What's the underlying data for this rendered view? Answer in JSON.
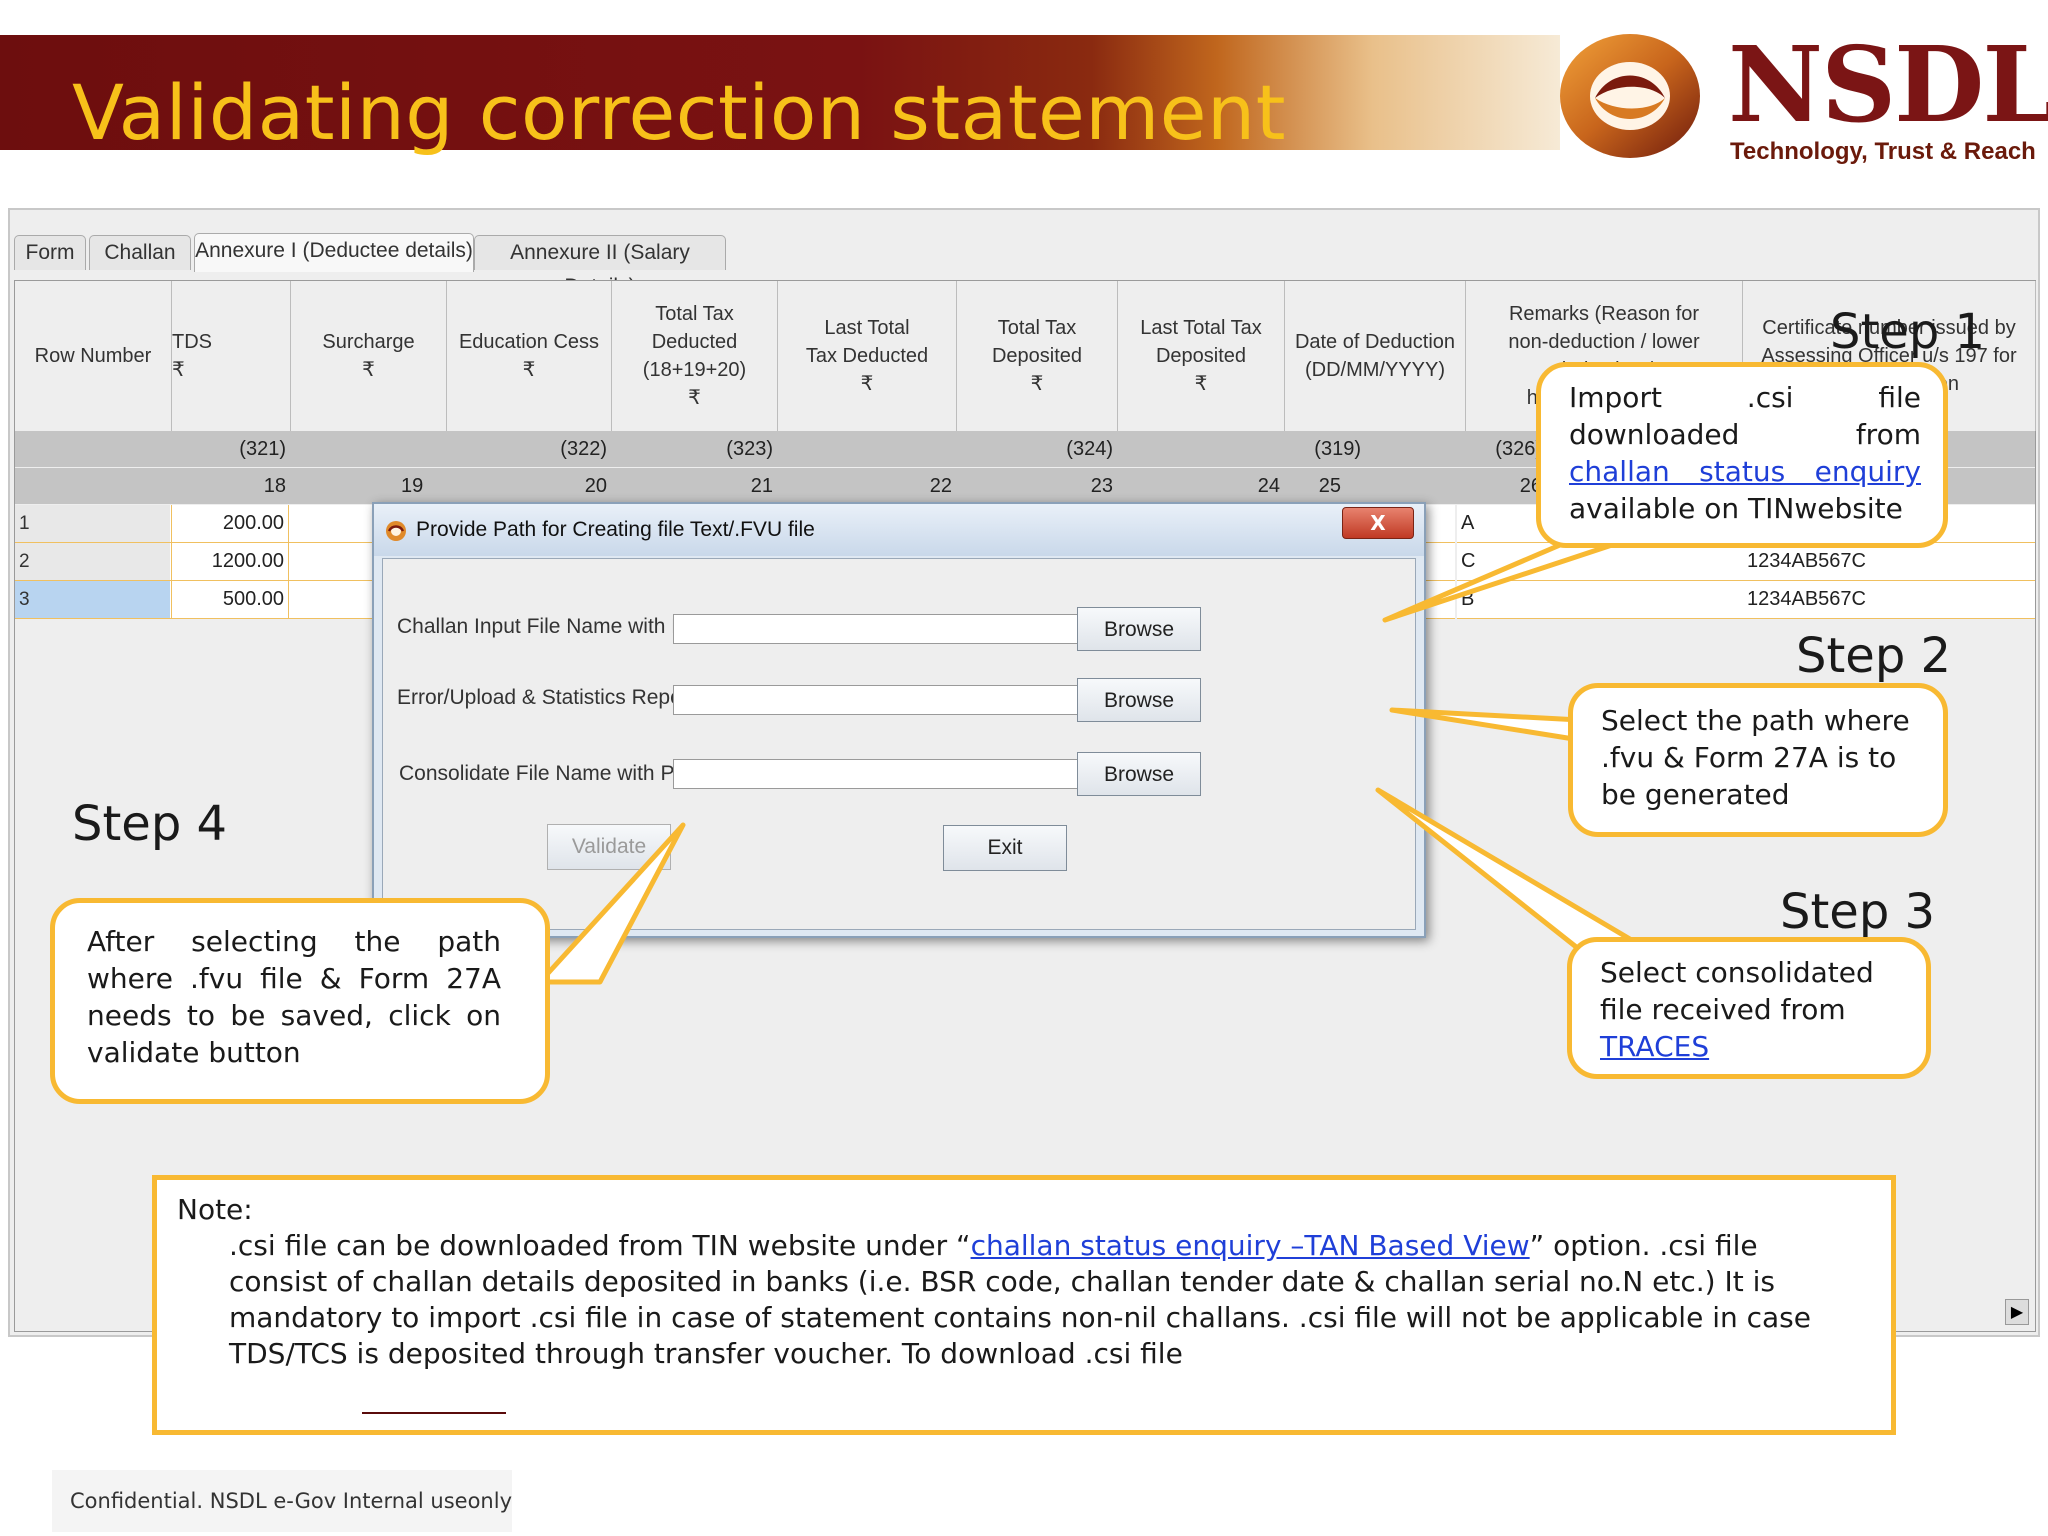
{
  "slide": {
    "title": "Validating correction statement",
    "logo_text": "NSDL",
    "logo_tagline": "Technology, Trust & Reach",
    "footer": "Confidential. NSDL e-Gov Internal useonly",
    "accent_color": "#f8b932",
    "banner_color": "#6d0e0e"
  },
  "app": {
    "tabs": [
      "Form",
      "Challan",
      "Annexure I (Deductee details)",
      "Annexure II (Salary Details)"
    ],
    "active_tab": "Annexure I (Deductee details)",
    "columns": [
      "Row Number",
      "TDS\n₹",
      "Surcharge\n₹",
      "Education Cess\n₹",
      "Total Tax Deducted\n(18+19+20)\n₹",
      "Last Total\nTax Deducted\n₹",
      "Total Tax\nDeposited\n₹",
      "Last Total Tax\nDeposited\n₹",
      "Date of Deduction\n(DD/MM/YYYY)",
      "Remarks (Reason for\nnon-deduction / lower deduction /\nhigher deduction)",
      "Certificate number issued by\nAssessing Officer u/s 197 for\nlower deduction"
    ],
    "code_row": [
      "",
      "(321)",
      "",
      "(322)",
      "(323)",
      "",
      "(324)",
      "",
      "(319)",
      "(326)",
      ""
    ],
    "index_row": [
      "",
      "18",
      "19",
      "20",
      "21",
      "22",
      "23",
      "24",
      "25",
      "26",
      ""
    ],
    "rows": [
      {
        "num": "1",
        "tds": "200.00",
        "remarks": "A",
        "certificate": ""
      },
      {
        "num": "2",
        "tds": "1200.00",
        "remarks": "C",
        "certificate": "1234AB567C"
      },
      {
        "num": "3",
        "tds": "500.00",
        "remarks": "B",
        "certificate": "1234AB567C"
      }
    ],
    "scroll_glyph": "▶"
  },
  "dialog": {
    "title": "Provide Path for Creating file Text/.FVU file",
    "close_label": "X",
    "fields": [
      {
        "label": "Challan Input File Name with Path",
        "value": "",
        "button": "Browse"
      },
      {
        "label": "Error/Upload & Statistics Report File Path",
        "value": "",
        "button": "Browse"
      },
      {
        "label": "Consolidate File Name with Path",
        "value": "",
        "button": "Browse"
      }
    ],
    "validate_label": "Validate",
    "exit_label": "Exit"
  },
  "steps": {
    "step1": {
      "heading": "Step 1",
      "line1_words": [
        "Import",
        ".csi",
        "file"
      ],
      "line2_words": [
        "downloaded",
        "from"
      ],
      "link": "challan status enquiry",
      "line4": "available on TINwebsite"
    },
    "step2": {
      "heading": "Step 2",
      "lines": [
        "Select the path where",
        ".fvu & Form 27A is to",
        "be generated"
      ]
    },
    "step3": {
      "heading": "Step 3",
      "lines": [
        "Select consolidated",
        "file received from"
      ],
      "link": "TRACES"
    },
    "step4": {
      "heading": "Step 4",
      "lines": [
        "After selecting the path",
        "where .fvu file & Form 27A",
        "needs to be saved, click on",
        "validate button"
      ]
    }
  },
  "note": {
    "label": "Note:",
    "line1_prefix": ".csi file can be downloaded from TIN website under “",
    "line1_link": "challan status enquiry –TAN Based View",
    "line1_suffix": "” option. .csi file",
    "line2": "consist of challan details deposited in banks (i.e. BSR code, challan tender date & challan serial no.N etc.) It is",
    "line3": "mandatory to import .csi file in case of statement contains non-nil challans. .csi file will not be applicable in case",
    "line4": "TDS/TCS is deposited through transfer voucher. To download .csi file"
  }
}
